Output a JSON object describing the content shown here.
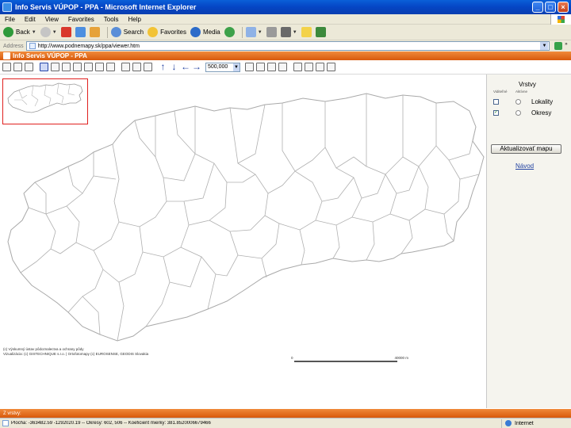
{
  "window": {
    "title": "Info Servis VÚPOP - PPA - Microsoft Internet Explorer",
    "min": "_",
    "max": "□",
    "close": "×"
  },
  "menu": [
    "File",
    "Edit",
    "View",
    "Favorites",
    "Tools",
    "Help"
  ],
  "toolbar": {
    "back": "Back",
    "search": "Search",
    "favorites": "Favorites",
    "media": "Media"
  },
  "address": {
    "label": "Address",
    "url": "http://www.podnemapy.sk/ppa/viewer.htm"
  },
  "app": {
    "title": "Info Servis VÚPOP - PPA"
  },
  "map": {
    "scale": "500,000",
    "credits_line1": "(c) Výskumný ústav pôdoznalectva a ochrany pôdy",
    "credits_line2": "Vizualizácia: (c) GISTECHNIQUE s.r.o. | Ortofotomapy (c) EUROSENSE, GEODIS Slovakia",
    "scale_left": "0",
    "scale_right": "40000 m"
  },
  "layers": {
    "title": "Vrstvy",
    "col_visible": "Viditeľné",
    "col_active": "Aktívne",
    "items": [
      {
        "label": "Lokality",
        "visible": false
      },
      {
        "label": "Okresy",
        "visible": true
      }
    ],
    "refresh_label": "Aktualizovať mapu",
    "help_label": "Návod"
  },
  "footer": {
    "text": "Z vrstvy:"
  },
  "status": {
    "text": "Plocha: -363482.59 -1292020.19 -- Okresy: 602, 506 -- Koeficient mierky: 381.8520006679466",
    "zone": "Internet"
  },
  "colors": {
    "accent": "#e8701c",
    "title_blue": "#0a4fc8",
    "district_lines": "#a9a9a9",
    "overview_frame": "#e0201f"
  }
}
